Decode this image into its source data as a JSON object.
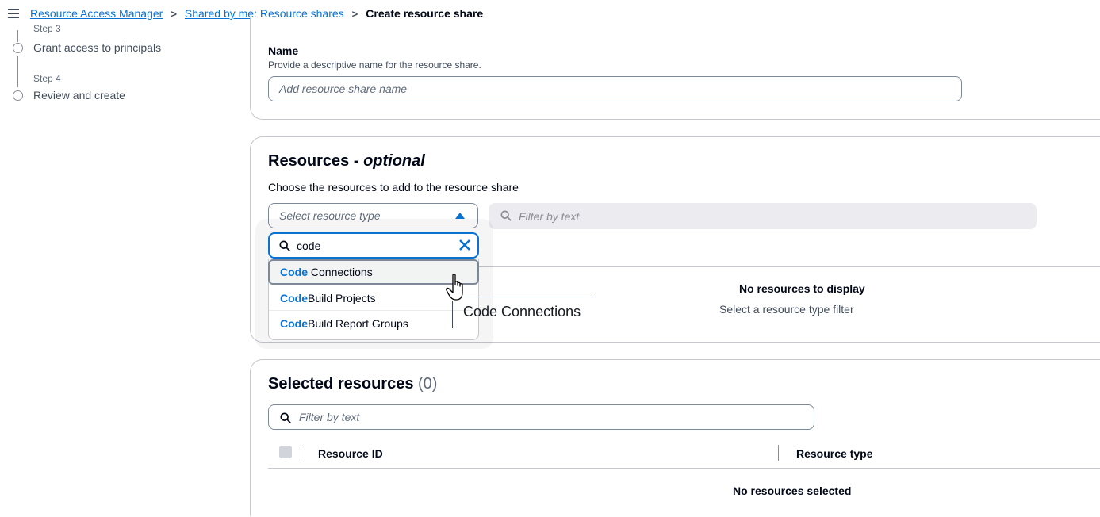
{
  "breadcrumb": {
    "items": [
      "Resource Access Manager",
      "Shared by me: Resource shares"
    ],
    "separator": ">",
    "current": "Create resource share"
  },
  "stepper": {
    "step3_num": "Step 3",
    "step3_label": "Grant access to principals",
    "step4_num": "Step 4",
    "step4_label": "Review and create"
  },
  "name_section": {
    "label": "Name",
    "description": "Provide a descriptive name for the resource share.",
    "input_placeholder": "Add resource share name"
  },
  "resources_section": {
    "title": "Resources - ",
    "title_optional": "optional",
    "description": "Choose the resources to add to the resource share",
    "select_placeholder": "Select resource type",
    "filter_placeholder": "Filter by text",
    "empty_title": "No resources to display",
    "empty_sub": "Select a resource type filter"
  },
  "dropdown": {
    "search_value": "code",
    "items": [
      {
        "match": "Code",
        "rest": " Connections"
      },
      {
        "match": "Code",
        "rest": "Build Projects"
      },
      {
        "match": "Code",
        "rest": "Build Report Groups"
      }
    ],
    "tooltip": "Code Connections"
  },
  "selected_section": {
    "title": "Selected resources ",
    "count": "(0)",
    "filter_placeholder": "Filter by text",
    "col_resource_id": "Resource ID",
    "col_resource_type": "Resource type",
    "empty": "No resources selected"
  },
  "colors": {
    "link": "#0972d3",
    "text": "#000716",
    "border": "#7d8998",
    "match_highlight": "#0972d3"
  }
}
